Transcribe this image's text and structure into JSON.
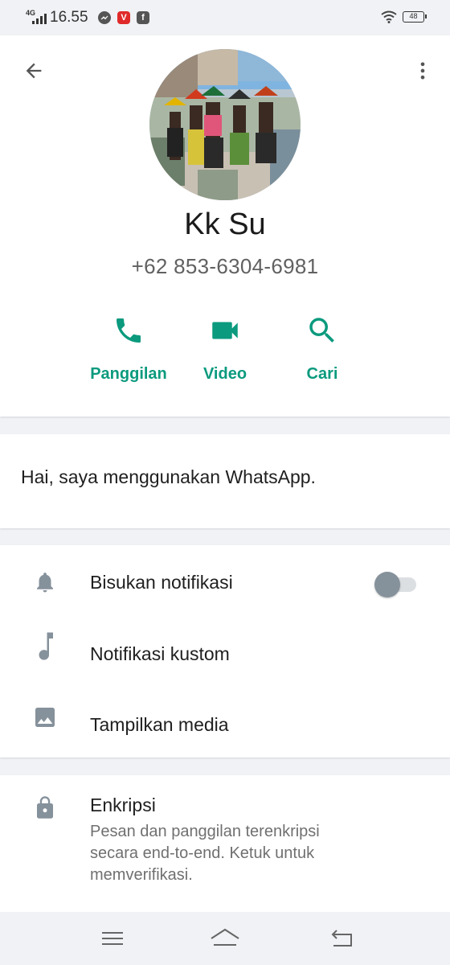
{
  "status_bar": {
    "network": "4G",
    "time": "16.55",
    "battery": "48",
    "app_icons": [
      "messenger-icon",
      "v-app-icon",
      "facebook-icon"
    ],
    "v_app_letter": "V",
    "fb_letter": "f"
  },
  "header": {
    "back_icon": "arrow-left-icon",
    "menu_icon": "more-vertical-icon"
  },
  "contact": {
    "name": "Kk Su",
    "phone": "+62 853-6304-6981"
  },
  "actions": [
    {
      "label": "Panggilan",
      "icon": "phone-icon"
    },
    {
      "label": "Video",
      "icon": "video-camera-icon"
    },
    {
      "label": "Cari",
      "icon": "search-icon"
    }
  ],
  "about": {
    "text": "Hai, saya menggunakan WhatsApp."
  },
  "settings": [
    {
      "label": "Bisukan notifikasi",
      "icon": "bell-icon",
      "toggle": false
    },
    {
      "label": "Notifikasi kustom",
      "icon": "music-note-icon"
    },
    {
      "label": "Tampilkan media",
      "icon": "image-icon"
    }
  ],
  "encryption": {
    "title": "Enkripsi",
    "description": "Pesan dan panggilan terenkripsi secara end-to-end. Ketuk untuk memverifikasi.",
    "icon": "lock-icon"
  },
  "colors": {
    "accent": "#0b9a7e",
    "icon_gray": "#85919b",
    "background": "#f0f2f5"
  }
}
